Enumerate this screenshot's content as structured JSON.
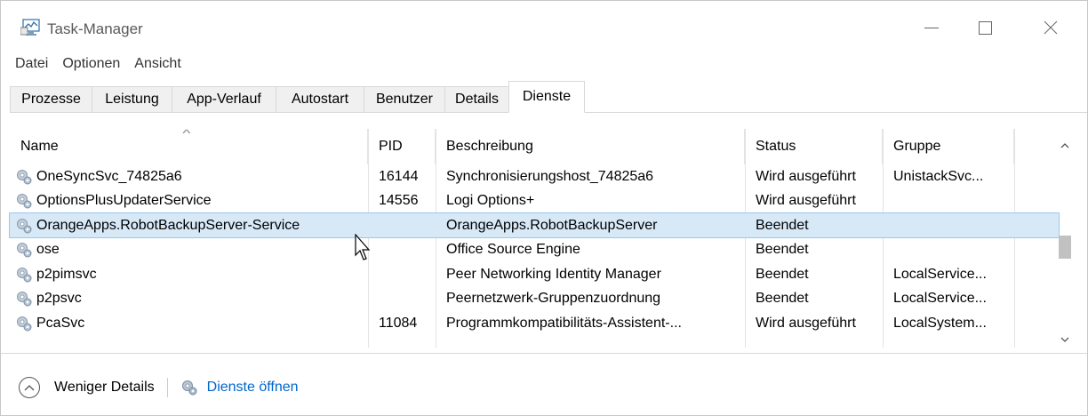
{
  "window": {
    "title": "Task-Manager"
  },
  "menu": {
    "items": [
      "Datei",
      "Optionen",
      "Ansicht"
    ]
  },
  "tabs": [
    {
      "label": "Prozesse",
      "active": false
    },
    {
      "label": "Leistung",
      "active": false
    },
    {
      "label": "App-Verlauf",
      "active": false
    },
    {
      "label": "Autostart",
      "active": false
    },
    {
      "label": "Benutzer",
      "active": false
    },
    {
      "label": "Details",
      "active": false
    },
    {
      "label": "Dienste",
      "active": true
    }
  ],
  "table": {
    "columns": [
      "Name",
      "PID",
      "Beschreibung",
      "Status",
      "Gruppe"
    ],
    "sorted_column": "Name",
    "rows": [
      {
        "name": "OneSyncSvc_74825a6",
        "pid": "16144",
        "description": "Synchronisierungshost_74825a6",
        "status": "Wird ausgeführt",
        "group": "UnistackSvc...",
        "selected": false
      },
      {
        "name": "OptionsPlusUpdaterService",
        "pid": "14556",
        "description": "Logi Options+",
        "status": "Wird ausgeführt",
        "group": "",
        "selected": false
      },
      {
        "name": "OrangeApps.RobotBackupServer-Service",
        "pid": "",
        "description": "OrangeApps.RobotBackupServer",
        "status": "Beendet",
        "group": "",
        "selected": true
      },
      {
        "name": "ose",
        "pid": "",
        "description": "Office  Source Engine",
        "status": "Beendet",
        "group": "",
        "selected": false
      },
      {
        "name": "p2pimsvc",
        "pid": "",
        "description": "Peer Networking Identity Manager",
        "status": "Beendet",
        "group": "LocalService...",
        "selected": false
      },
      {
        "name": "p2psvc",
        "pid": "",
        "description": "Peernetzwerk-Gruppenzuordnung",
        "status": "Beendet",
        "group": "LocalService...",
        "selected": false
      },
      {
        "name": "PcaSvc",
        "pid": "11084",
        "description": "Programmkompatibilitäts-Assistent-...",
        "status": "Wird ausgeführt",
        "group": "LocalSystem...",
        "selected": false
      }
    ]
  },
  "footer": {
    "fewer_details": "Weniger Details",
    "open_services": "Dienste öffnen"
  },
  "icons": {
    "app": "task-manager-icon",
    "service": "gear-icon",
    "collapse": "chevron-up-icon"
  },
  "colors": {
    "selection": "#d7e8f7",
    "link": "#0066cc"
  }
}
